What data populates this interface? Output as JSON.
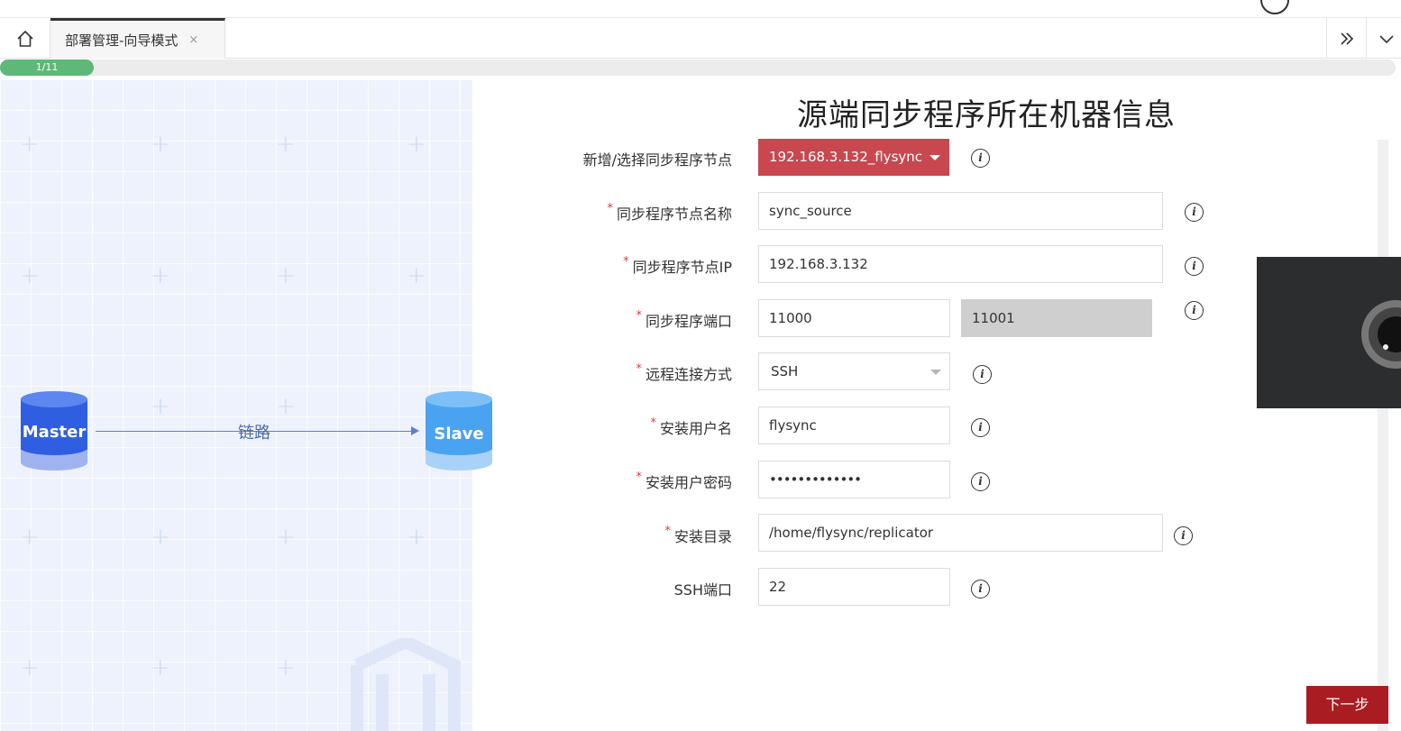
{
  "tabs": {
    "home_icon": "home-icon",
    "active_tab_label": "部署管理-向导模式",
    "close_glyph": "×",
    "expand_icon": "double-chevron-right-icon",
    "menu_icon": "chevron-down-icon"
  },
  "progress": {
    "label": "1/11",
    "current": 1,
    "total": 11
  },
  "diagram": {
    "master_label": "Master",
    "slave_label": "Slave",
    "link_label": "链路"
  },
  "form": {
    "title": "源端同步程序所在机器信息",
    "node_select": {
      "label": "新增/选择同步程序节点",
      "value": "192.168.3.132_flysync"
    },
    "node_name": {
      "required_mark": "*",
      "label": "同步程序节点名称",
      "value": "sync_source"
    },
    "node_ip": {
      "required_mark": "*",
      "label": "同步程序节点IP",
      "value": "192.168.3.132"
    },
    "node_port": {
      "required_mark": "*",
      "label": "同步程序端口",
      "value": "11000",
      "value2": "11001"
    },
    "remote_method": {
      "required_mark": "*",
      "label": "远程连接方式",
      "value": "SSH"
    },
    "install_user": {
      "required_mark": "*",
      "label": "安装用户名",
      "value": "flysync"
    },
    "install_password": {
      "required_mark": "*",
      "label": "安装用户密码",
      "value": "•••••••••••••"
    },
    "install_dir": {
      "required_mark": "*",
      "label": "安装目录",
      "value": "/home/flysync/replicator"
    },
    "ssh_port": {
      "label": "SSH端口",
      "value": "22"
    },
    "info_glyph": "i"
  },
  "footer": {
    "next_label": "下一步"
  },
  "colors": {
    "progress_green": "#5fb878",
    "select_red": "#c9474f",
    "next_button": "#a91d22",
    "diagram_bg": "#eef2fc",
    "master_blue": "#2f5fe0",
    "slave_blue": "#4aa3f0"
  }
}
